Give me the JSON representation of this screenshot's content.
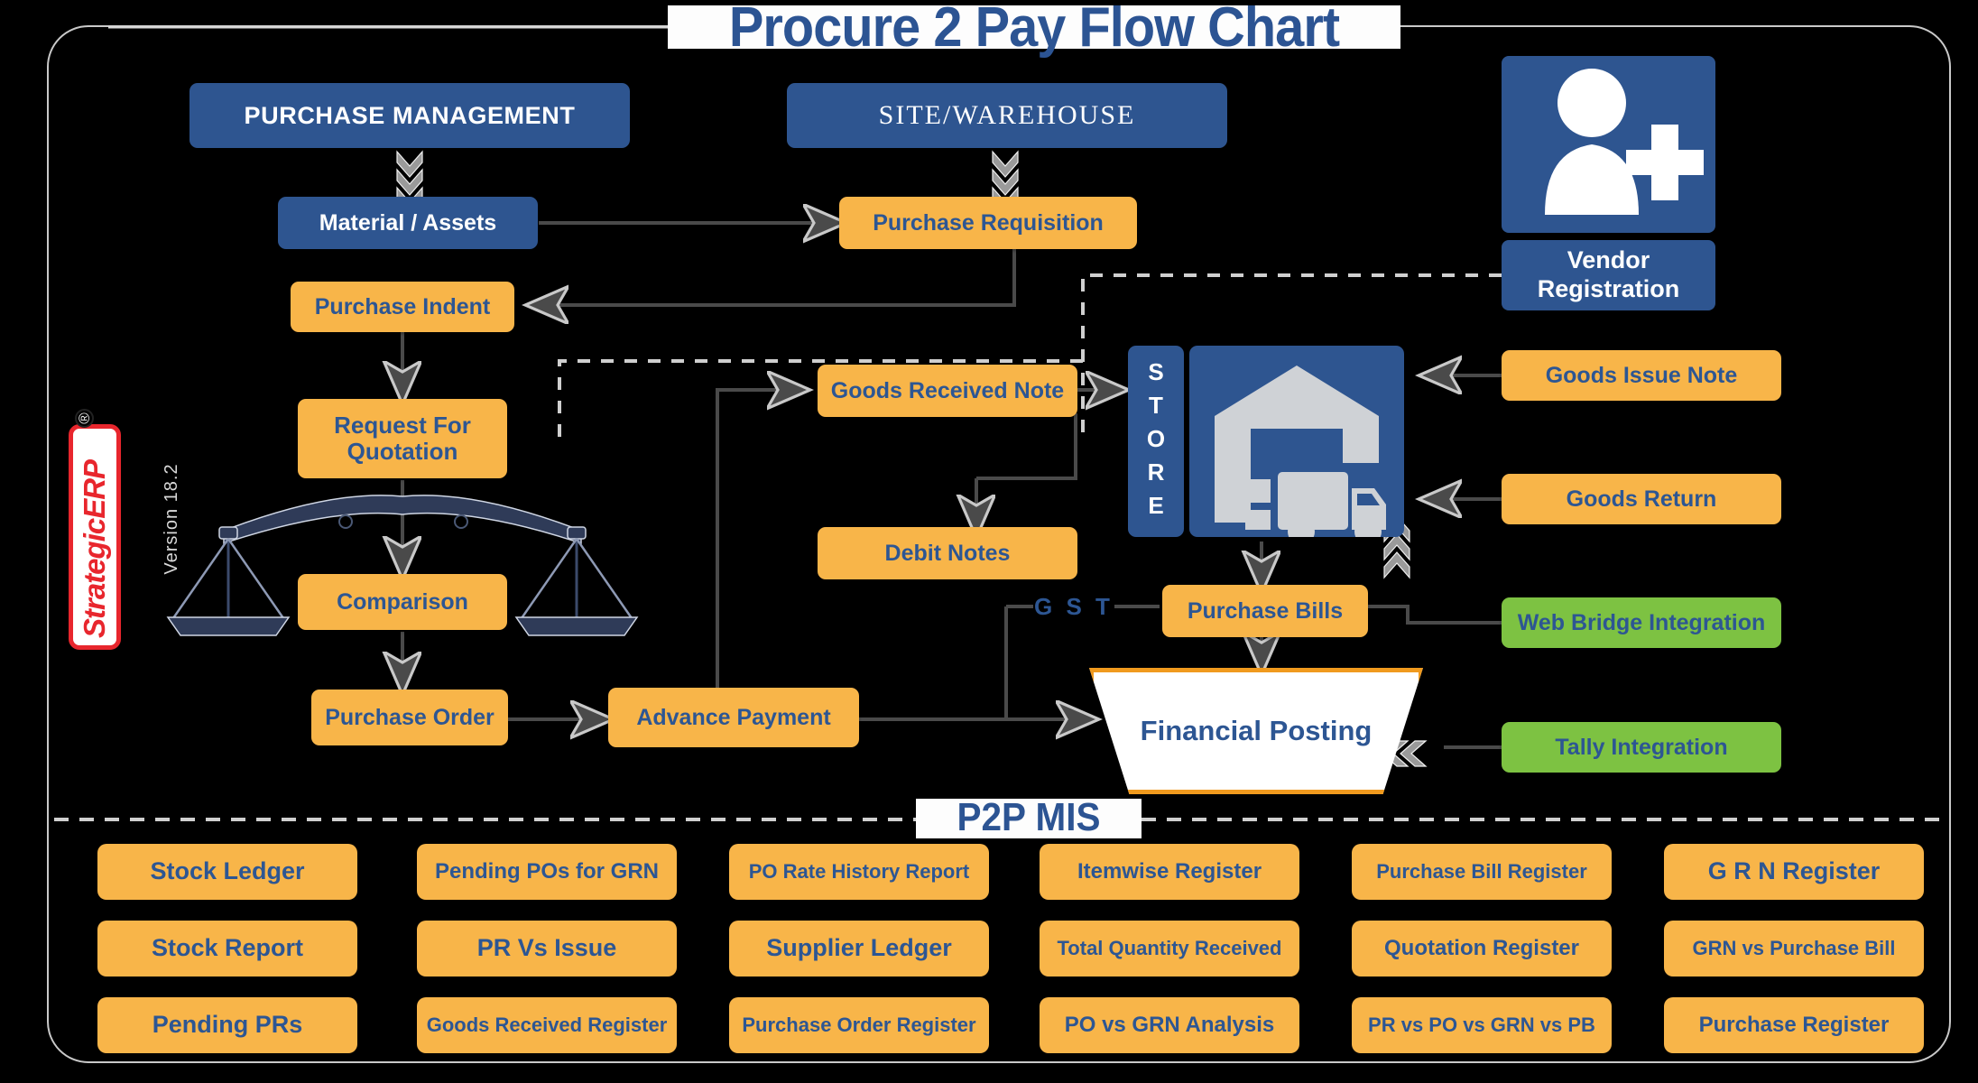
{
  "title": "Procure 2 Pay Flow Chart",
  "brand": {
    "logo": "StrategicERP",
    "registered": "®",
    "version": "Version 18.2"
  },
  "headers": {
    "purchase_management": "PURCHASE MANAGEMENT",
    "site_warehouse": "SITE/WAREHOUSE"
  },
  "nodes": {
    "material_assets": "Material / Assets",
    "purchase_requisition": "Purchase Requisition",
    "purchase_indent": "Purchase Indent",
    "request_for_quotation": "Request For Quotation",
    "comparison": "Comparison",
    "purchase_order": "Purchase Order",
    "advance_payment": "Advance Payment",
    "goods_received_note": "Goods Received Note",
    "debit_notes": "Debit Notes",
    "store": "STORE",
    "goods_issue_note": "Goods Issue Note",
    "goods_return": "Goods  Return",
    "purchase_bills": "Purchase Bills",
    "web_bridge_integration": "Web Bridge Integration",
    "tally_integration": "Tally Integration",
    "financial_posting": "Financial Posting",
    "vendor_registration": "Vendor Registration",
    "gst": "G S T"
  },
  "mis": {
    "heading": "P2P MIS",
    "columns": [
      [
        "Stock Ledger",
        "Stock Report",
        "Pending PRs"
      ],
      [
        "Pending POs for GRN",
        "PR Vs Issue",
        "Goods Received Register"
      ],
      [
        "PO Rate History Report",
        "Supplier Ledger",
        "Purchase Order Register"
      ],
      [
        "Itemwise Register",
        "Total Quantity Received",
        "PO vs GRN Analysis"
      ],
      [
        "Purchase Bill Register",
        "Quotation Register",
        "PR vs PO vs GRN vs PB"
      ],
      [
        "G R N Register",
        "GRN vs Purchase Bill",
        "Purchase Register"
      ]
    ]
  },
  "icons": {
    "warehouse": "warehouse-truck-icon",
    "vendor": "user-plus-icon",
    "balance": "balance-scale-icon"
  },
  "colors": {
    "blue": "#2E5590",
    "orange": "#F8B549",
    "green": "#7DC242",
    "text_blue": "#2D5693",
    "trapezoid_border": "#F09A1E",
    "background": "#000000"
  }
}
